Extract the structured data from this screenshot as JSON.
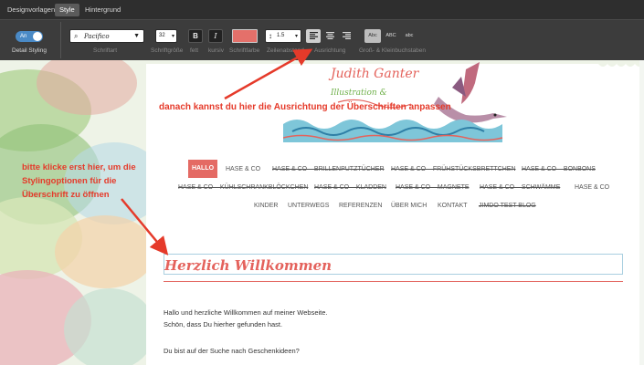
{
  "tabs": [
    {
      "label": "Designvorlagen"
    },
    {
      "label": "Style"
    },
    {
      "label": "Hintergrund"
    }
  ],
  "toolbar": {
    "toggle_label": "An",
    "detail_label": "Detail Styling",
    "font_value": "Pacifico",
    "font_size_value": "32",
    "line_height_value": "1.5",
    "bold_glyph": "B",
    "italic_glyph": "I",
    "case_options": [
      "Abc",
      "ABC",
      "abc"
    ],
    "labels": {
      "schriftart": "Schriftart",
      "schriftgroesse": "Schriftgröße",
      "fett": "fett",
      "kursiv": "kursiv",
      "schriftfarbe": "Schriftfarbe",
      "zeilenabstand": "Zeilenabstand",
      "ausrichtung": "Ausrichtung",
      "gross_klein": "Groß- & Kleinbuchstaben"
    },
    "colors": {
      "text_color": "#e4706a"
    }
  },
  "logo": {
    "title": "Judith Ganter",
    "subtitle": "Illustration &"
  },
  "nav": {
    "active": "HALLO",
    "items": [
      "HASE & CO",
      "HASE & CO – BRILLENPUTZTÜCHER",
      "HASE & CO – FRÜHSTÜCKSBRETTCHEN",
      "HASE & CO – BONBONS",
      "HASE & CO – KÜHLSCHRANKBLÖCKCHEN",
      "HASE & CO – KLADDEN",
      "HASE & CO – MAGNETE",
      "HASE & CO – SCHWÄMME",
      "HASE & CO",
      "KINDER",
      "UNTERWEGS",
      "REFERENZEN",
      "ÜBER MICH",
      "KONTAKT",
      "JIMDO TEST BLOG"
    ]
  },
  "content": {
    "heading": "Herzlich Willkommen",
    "para1": "Hallo und herzliche Willkommen auf meiner Webseite.",
    "para2": "Schön, dass Du hierher gefunden hast.",
    "para3": "Du bist auf der Suche nach Geschenkideen?"
  },
  "annotations": {
    "top": "danach kannst du hier die Ausrichtung der Überschriften anpassen",
    "left": "bitte klicke erst hier, um die Stylingoptionen für die Überschrift zu öffnen"
  }
}
